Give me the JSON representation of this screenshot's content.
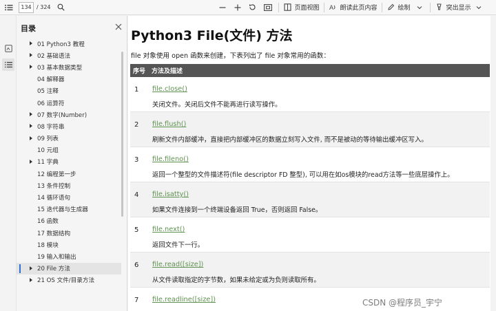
{
  "toolbar": {
    "page_current": "134",
    "page_total": "/ 324",
    "view_label": "页面视图",
    "read_aloud_label": "朗读此页内容",
    "draw_label": "绘制",
    "highlight_label": "突出显示"
  },
  "outline": {
    "title": "目录",
    "items": [
      {
        "label": "01 Python3 教程",
        "caret": true
      },
      {
        "label": "02 基础语法",
        "caret": true
      },
      {
        "label": "03 基本数据类型",
        "caret": true
      },
      {
        "label": "04 解释器",
        "caret": false
      },
      {
        "label": "05 注释",
        "caret": false
      },
      {
        "label": "06 运算符",
        "caret": false
      },
      {
        "label": "07 数字(Number)",
        "caret": true
      },
      {
        "label": "08 字符串",
        "caret": true
      },
      {
        "label": "09 列表",
        "caret": true
      },
      {
        "label": "10 元组",
        "caret": false
      },
      {
        "label": "11 字典",
        "caret": true
      },
      {
        "label": "12 编程第一步",
        "caret": false
      },
      {
        "label": "13 条件控制",
        "caret": false
      },
      {
        "label": "14 循环语句",
        "caret": false
      },
      {
        "label": "15 迭代器与生成器",
        "caret": false
      },
      {
        "label": "16 函数",
        "caret": false
      },
      {
        "label": "17 数据结构",
        "caret": false
      },
      {
        "label": "18 模块",
        "caret": false
      },
      {
        "label": "19 输入和输出",
        "caret": false
      },
      {
        "label": "20 File 方法",
        "caret": true,
        "active": true
      },
      {
        "label": "21 OS 文件/目录方法",
        "caret": true
      }
    ]
  },
  "document": {
    "title": "Python3 File(文件) 方法",
    "intro": "file 对象使用 open 函数来创建，下表列出了 file 对象常用的函数：",
    "table": {
      "headers": [
        "序号",
        "方法及描述"
      ],
      "rows": [
        {
          "no": "1",
          "method": "file.close()",
          "desc": "关闭文件。关闭后文件不能再进行读写操作。"
        },
        {
          "no": "2",
          "method": "file.flush()",
          "desc": "刷新文件内部缓冲，直接把内部缓冲区的数据立刻写入文件, 而不是被动的等待输出缓冲区写入。"
        },
        {
          "no": "3",
          "method": "file.fileno()",
          "desc": "返回一个整型的文件描述符(file descriptor FD 整型), 可以用在如os模块的read方法等一些底层操作上。"
        },
        {
          "no": "4",
          "method": "file.isatty()",
          "desc": "如果文件连接到一个终端设备返回 True，否则返回 False。"
        },
        {
          "no": "5",
          "method": "file.next()",
          "desc": "返回文件下一行。"
        },
        {
          "no": "6",
          "method": "file.read([size])",
          "desc": "从文件读取指定的字节数，如果未给定或为负则读取所有。"
        },
        {
          "no": "7",
          "method": "file.readline([size])",
          "desc": ""
        }
      ]
    },
    "watermark": "CSDN @程序员_宇宁"
  },
  "colors": {
    "link": "#5f9150",
    "table_header_bg": "#555555",
    "active_marker": "#2f6fd0"
  }
}
